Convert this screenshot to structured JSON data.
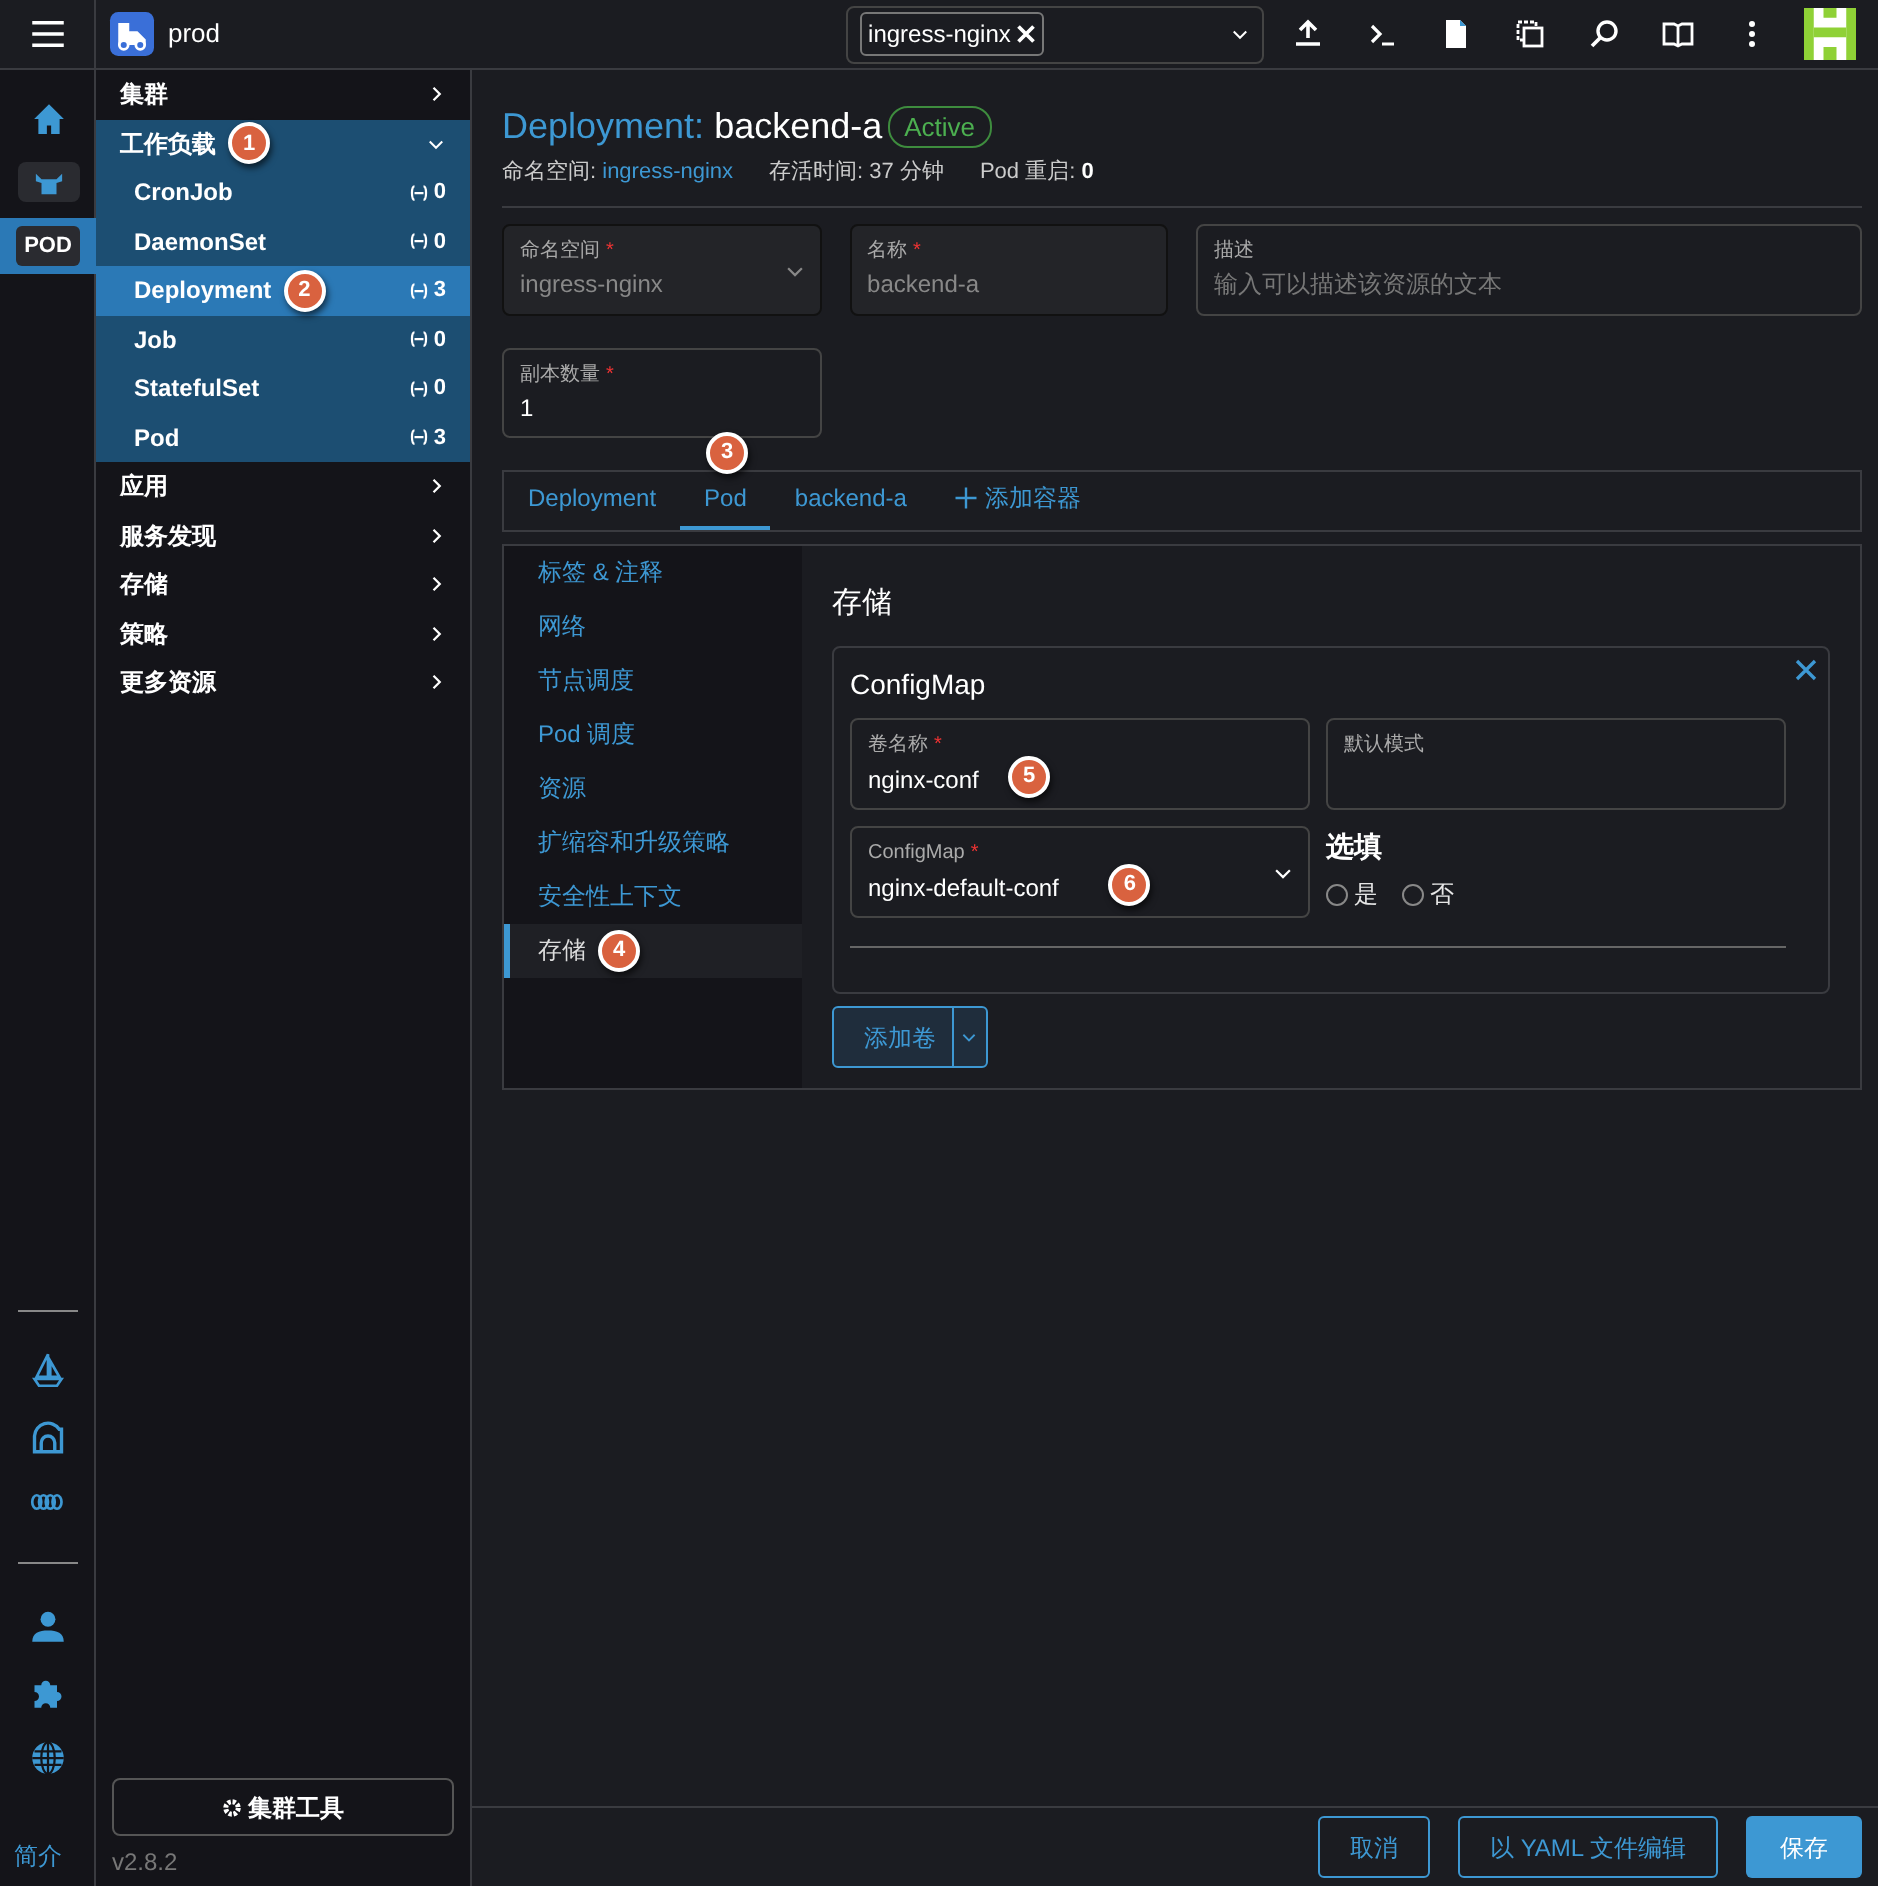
{
  "topbar": {
    "cluster_name": "prod",
    "namespace_chip": "ingress-nginx",
    "tools": [
      {
        "kind": "upload"
      },
      {
        "kind": "terminal"
      },
      {
        "kind": "file"
      },
      {
        "kind": "copy"
      },
      {
        "kind": "search"
      },
      {
        "kind": "book"
      },
      {
        "kind": "more"
      }
    ]
  },
  "rail": {
    "top": [
      {
        "kind": "home",
        "selected": false
      },
      {
        "kind": "cow",
        "selected": false
      },
      {
        "kind": "pod",
        "label": "POD",
        "selected": true
      }
    ],
    "bottom": [
      {
        "kind": "sailboat"
      },
      {
        "kind": "building"
      },
      {
        "kind": "rope"
      },
      {
        "kind": "user"
      },
      {
        "kind": "extension"
      },
      {
        "kind": "globe"
      }
    ],
    "about_link": "简介"
  },
  "nav": {
    "groups": [
      {
        "label": "集群",
        "expanded": false
      },
      {
        "label": "工作负载",
        "expanded": true,
        "marker": "1",
        "children": [
          {
            "label": "CronJob",
            "count": "0",
            "selected": false
          },
          {
            "label": "DaemonSet",
            "count": "0",
            "selected": false
          },
          {
            "label": "Deployment",
            "count": "3",
            "selected": true,
            "marker": "2"
          },
          {
            "label": "Job",
            "count": "0",
            "selected": false
          },
          {
            "label": "StatefulSet",
            "count": "0",
            "selected": false
          },
          {
            "label": "Pod",
            "count": "3",
            "selected": false
          }
        ]
      },
      {
        "label": "应用",
        "expanded": false
      },
      {
        "label": "服务发现",
        "expanded": false
      },
      {
        "label": "存储",
        "expanded": false
      },
      {
        "label": "策略",
        "expanded": false
      },
      {
        "label": "更多资源",
        "expanded": false
      }
    ],
    "cluster_tools_button": "集群工具",
    "version": "v2.8.2"
  },
  "header": {
    "type": "Deployment:",
    "name": "backend-a",
    "status": "Active",
    "meta": [
      {
        "label": "命名空间:",
        "value": "ingress-nginx",
        "kind": "link"
      },
      {
        "label": "存活时间:",
        "value": "37 分钟",
        "kind": "plain"
      },
      {
        "label": "Pod 重启:",
        "value": "0",
        "kind": "bold"
      }
    ]
  },
  "form": {
    "namespace": {
      "label": "命名空间",
      "required_mark": "*",
      "value": "ingress-nginx",
      "disabled": true
    },
    "name": {
      "label": "名称",
      "required_mark": "*",
      "value": "backend-a",
      "disabled": true
    },
    "description": {
      "label": "描述",
      "placeholder": "输入可以描述该资源的文本"
    },
    "replicas": {
      "label": "副本数量",
      "required_mark": "*",
      "value": "1"
    }
  },
  "tabs": [
    {
      "label": "Deployment",
      "selected": false
    },
    {
      "label": "Pod",
      "selected": true,
      "marker": "3"
    },
    {
      "label": "backend-a",
      "selected": false
    }
  ],
  "add_container": "添加容器",
  "side_tabs": [
    {
      "label": "标签 & 注释",
      "selected": false
    },
    {
      "label": "网络",
      "selected": false
    },
    {
      "label": "节点调度",
      "selected": false
    },
    {
      "label": "Pod 调度",
      "selected": false
    },
    {
      "label": "资源",
      "selected": false
    },
    {
      "label": "扩缩容和升级策略",
      "selected": false
    },
    {
      "label": "安全性上下文",
      "selected": false
    },
    {
      "label": "存储",
      "selected": true,
      "marker": "4"
    }
  ],
  "storage": {
    "title": "存储",
    "volume": {
      "title": "ConfigMap",
      "volume_name": {
        "label": "卷名称",
        "required_mark": "*",
        "value": "nginx-conf",
        "marker": "5"
      },
      "default_mode": {
        "label": "默认模式"
      },
      "config_map": {
        "label": "ConfigMap",
        "required_mark": "*",
        "value": "nginx-default-conf",
        "marker": "6"
      },
      "optional": {
        "label": "选填",
        "options": [
          {
            "label": "是",
            "selected": false
          },
          {
            "label": "否",
            "selected": false
          }
        ]
      }
    },
    "add_volume": "添加卷"
  },
  "footer": {
    "buttons": [
      {
        "label": "取消",
        "kind": "outline"
      },
      {
        "label": "以 YAML 文件编辑",
        "kind": "outline"
      },
      {
        "label": "保存",
        "kind": "primary"
      }
    ]
  }
}
